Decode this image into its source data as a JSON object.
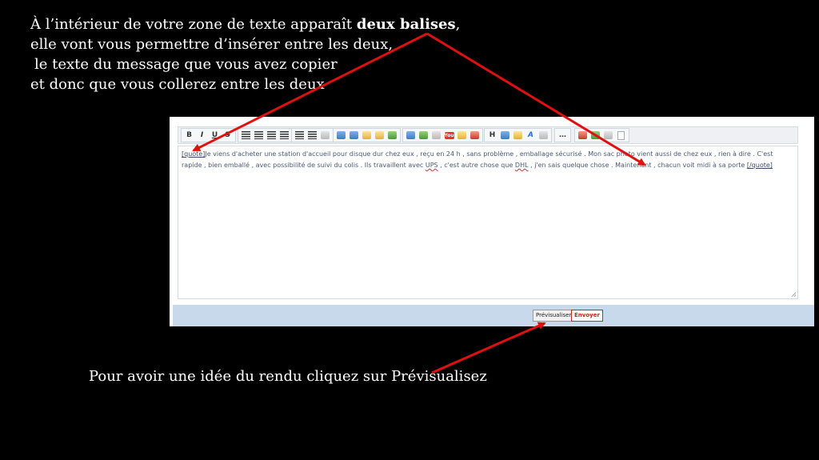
{
  "instructions": {
    "top_line1_before": "À l’intérieur de votre zone de texte apparaît ",
    "top_line1_bold": "deux balises",
    "top_line1_after": ",",
    "top_line2": "elle vont vous permettre d’insérer entre les deux,",
    "top_line3": "le texte du message que vous avez copier",
    "top_line4": "et donc que vous collerez entre les deux",
    "bottom": "Pour avoir une idée du rendu cliquez sur Prévisualisez"
  },
  "editor": {
    "toolbar": {
      "bold": "B",
      "italic": "I",
      "underline": "U",
      "strike": "S",
      "heading": "H"
    },
    "message": {
      "open_tag": "[quote]",
      "text_part1": "Je viens d'acheter une station d'accueil pour disque dur chez eux , reçu en 24 h , sans problème , emballage sécurisé . Mon sac photo vient aussi de chez eux , rien à dire . C'est rapide , bien emballé , avec possibilité de suivi du colis . Ils travaillent avec ",
      "ups": "UPS",
      "text_part2": " , c'est autre chose que ",
      "dhl": "DHL",
      "text_part3": " , j'en sais quelque chose . Maintenant , chacun voit midi à sa porte ",
      "close_tag": "[/quote]"
    },
    "buttons": {
      "preview": "Prévisualiser",
      "send": "Envoyer"
    }
  },
  "colors": {
    "background": "#000000",
    "arrow": "#e01010",
    "button_bar": "#c7d9ea",
    "send_border": "#cc2222"
  }
}
